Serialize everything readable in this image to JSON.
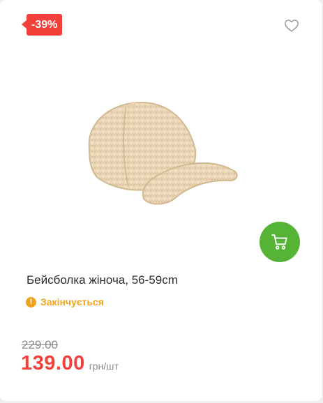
{
  "product": {
    "discount_badge": "-39%",
    "title": "Бейсболка жіноча, 56-59cm",
    "stock_status": "Закінчується",
    "old_price": "229.00",
    "price": "139.00",
    "unit": "грн/шт"
  },
  "icons": {
    "favorite": "heart-outline-icon",
    "cart": "shopping-cart-icon",
    "stock_warning": "exclamation-circle-icon"
  },
  "colors": {
    "badge": "#f2403a",
    "price": "#f2403a",
    "cart_button": "#55b436",
    "stock_warning": "#f1a41b"
  }
}
